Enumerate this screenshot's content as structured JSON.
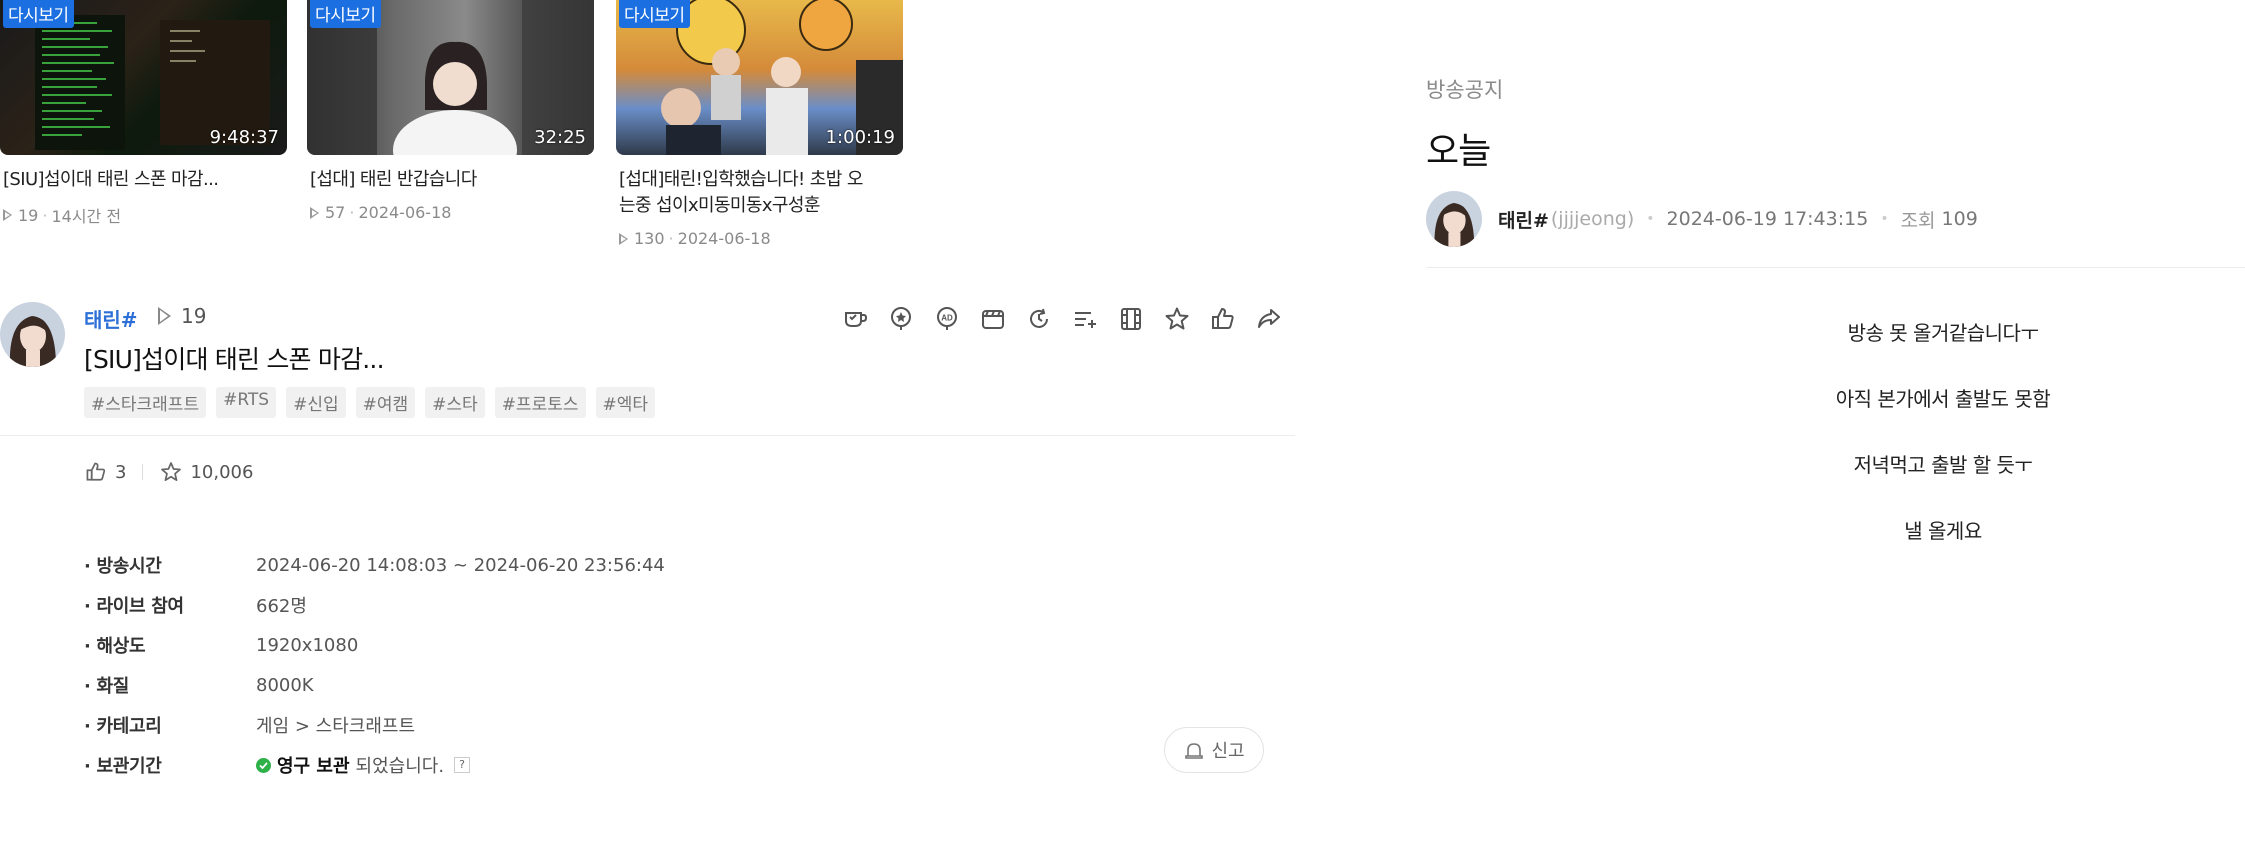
{
  "vods": [
    {
      "badge": "다시보기",
      "duration": "9:48:37",
      "title": "[SIU]섭이대 태린 스폰 마감...",
      "views": "19",
      "date": "14시간 전"
    },
    {
      "badge": "다시보기",
      "duration": "32:25",
      "title": "[섭대] 태린 반갑습니다",
      "views": "57",
      "date": "2024-06-18"
    },
    {
      "badge": "다시보기",
      "duration": "1:00:19",
      "title": "[섭대]태린!입학했습니다! 초밥 오는중 섭이x미동미동x구성훈",
      "views": "130",
      "date": "2024-06-18"
    }
  ],
  "player": {
    "streamer": "태린#",
    "views": "19",
    "title": "[SIU]섭이대 태린 스폰 마감...",
    "tags": [
      "#스타크래프트",
      "#RTS",
      "#신입",
      "#여캠",
      "#스타",
      "#프로토스",
      "#엑타"
    ],
    "actions": [
      "balloon-icon",
      "star-balloon-icon",
      "ad-balloon-icon",
      "clip-icon",
      "timeline-icon",
      "playlist-add-icon",
      "film-icon",
      "favorite-icon",
      "thumbs-up-icon",
      "share-icon"
    ],
    "likes": "3",
    "favorites": "10,006"
  },
  "details": [
    {
      "label": "· 방송시간",
      "value": "2024-06-20 14:08:03 ~ 2024-06-20 23:56:44"
    },
    {
      "label": "· 라이브 참여",
      "value": "662명"
    },
    {
      "label": "· 해상도",
      "value": "1920x1080"
    },
    {
      "label": "· 화질",
      "value": "8000K"
    },
    {
      "label": "· 카테고리",
      "value": "게임 > 스타크래프트"
    },
    {
      "label": "· 보관기간",
      "keep_strong": "영구 보관",
      "keep_rest": "되었습니다.",
      "help": "?"
    }
  ],
  "report_label": "신고",
  "notice": {
    "section": "방송공지",
    "title": "오늘",
    "author_name": "태린#",
    "author_id": "(jjjjeong)",
    "date": "2024-06-19 17:43:15",
    "views_label": "조회",
    "views": "109",
    "lines": [
      "방송 못 올거같습니다ㅜ",
      "아직 본가에서 출발도 못함",
      "저녁먹고 출발 할 듯ㅜ",
      "낼 올게요"
    ]
  },
  "colors": {
    "accent": "#2c6fd6",
    "badge": "#1b6fe0",
    "ok": "#2fb14a"
  }
}
